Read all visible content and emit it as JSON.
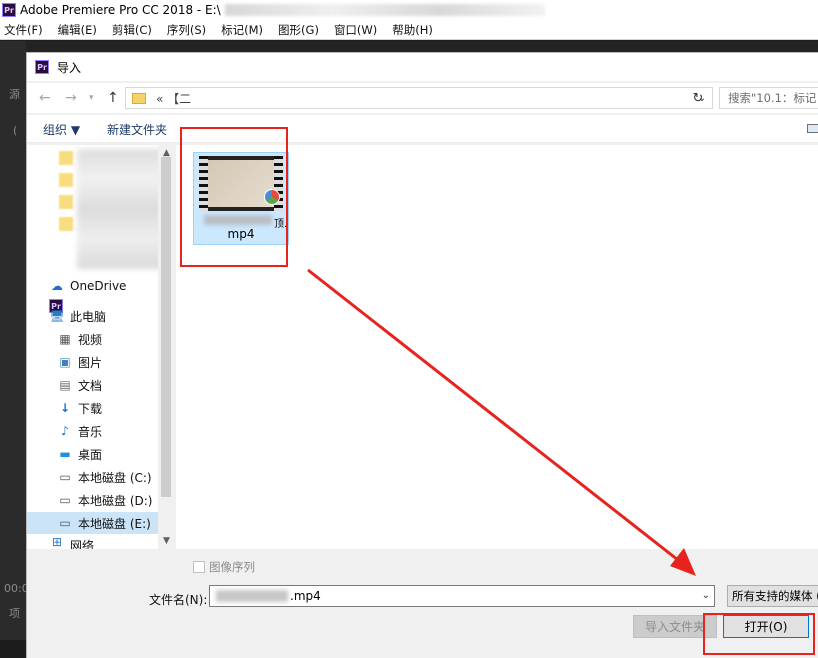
{
  "app": {
    "title": "Adobe Premiere Pro CC 2018 - E:\\",
    "badge": "Pr",
    "menu": [
      "文件(F)",
      "编辑(E)",
      "剪辑(C)",
      "序列(S)",
      "标记(M)",
      "图形(G)",
      "窗口(W)",
      "帮助(H)"
    ],
    "side_labels": [
      "源",
      "(",
      "00:0",
      "项"
    ]
  },
  "dialog": {
    "title": "导入",
    "address": {
      "crumb": "«  【二"
    },
    "search_placeholder": "搜索\"10.1：标记",
    "toolbar": {
      "organize": "组织 ▼",
      "new_folder": "新建文件夹"
    },
    "nav": {
      "items": [
        {
          "label": "OneDrive",
          "icon": "cloud-icon"
        },
        {
          "label": "此电脑",
          "icon": "computer-icon"
        },
        {
          "label": "视频",
          "icon": "video-icon"
        },
        {
          "label": "图片",
          "icon": "pictures-icon"
        },
        {
          "label": "文档",
          "icon": "documents-icon"
        },
        {
          "label": "下载",
          "icon": "download-icon"
        },
        {
          "label": "音乐",
          "icon": "music-icon"
        },
        {
          "label": "桌面",
          "icon": "desktop-icon"
        },
        {
          "label": "本地磁盘 (C:)",
          "icon": "drive-icon"
        },
        {
          "label": "本地磁盘 (D:)",
          "icon": "drive-icon"
        },
        {
          "label": "本地磁盘 (E:)",
          "icon": "drive-icon",
          "selected": true
        },
        {
          "label": "网络",
          "icon": "network-icon"
        }
      ]
    },
    "file": {
      "name": "mp4",
      "name_tail": "顶."
    },
    "image_sequence_label": "图像序列",
    "filename_label": "文件名(N):",
    "filename_value": ".mp4",
    "filetype_value": "所有支持的媒体 (",
    "import_folder_button": "导入文件夹",
    "open_button": "打开(O)"
  },
  "colors": {
    "annotation": "#e8231e",
    "selection": "#cce8ff",
    "accent": "#0078d7"
  }
}
